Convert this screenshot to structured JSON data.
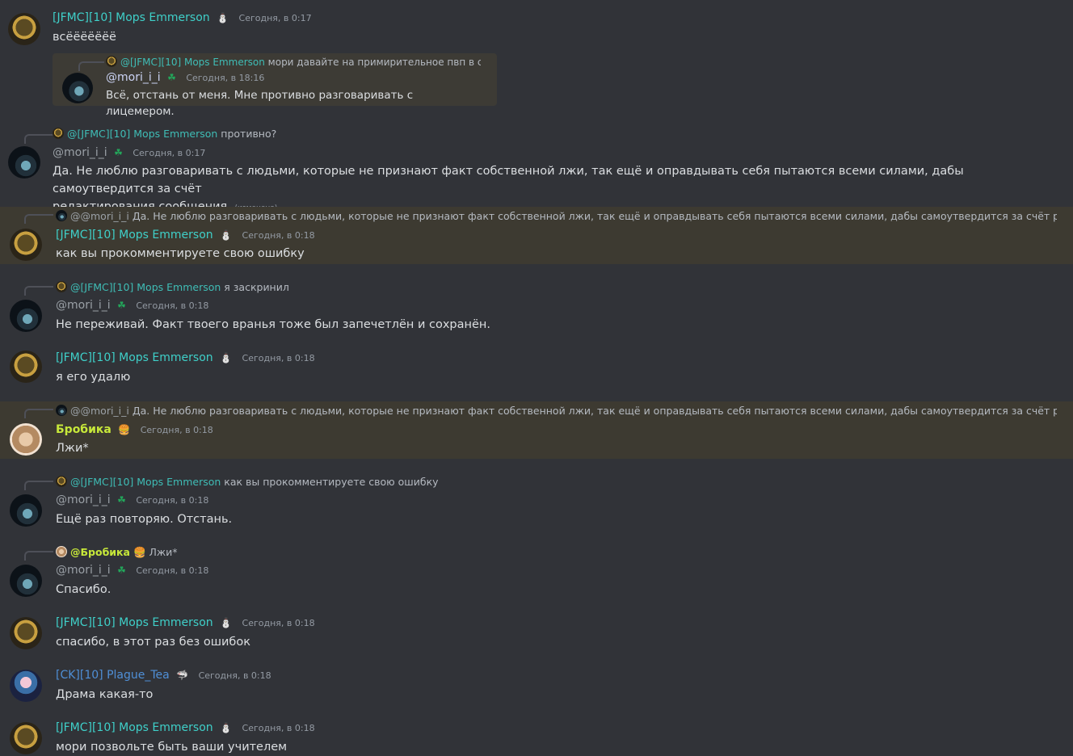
{
  "messages": [
    {
      "author": "[JFMC][10] Mops Emmerson",
      "badge": "⛄",
      "timestamp": "Сегодня, в 0:17",
      "text": "всёёёёёёё",
      "quote": {
        "reply_author": "@[JFMC][10] Mops Emmerson",
        "reply_text": "мори давайте на примирительное пвп в самп?",
        "author": "@mori_i_i",
        "badge": "☘",
        "timestamp": "Сегодня, в 18:16",
        "text": "Всё, отстань от меня. Мне противно разговаривать с лицемером."
      }
    },
    {
      "reply_author": "@[JFMC][10] Mops Emmerson",
      "reply_text": "противно?",
      "author": "@mori_i_i",
      "badge": "☘",
      "timestamp": "Сегодня, в 0:17",
      "text_line1": "Да. Не люблю разговаривать с людьми, которые не признают факт собственной лжи, так ещё и оправдывать себя пытаются всеми силами, дабы самоутвердится за счёт",
      "text_line2": "редактирования сообщения.",
      "edited": "(изменено)"
    },
    {
      "reply_author": "@@mori_i_i",
      "reply_text": "Да. Не люблю разговаривать с людьми, которые не признают факт собственной лжи, так ещё и оправдывать себя пытаются всеми силами, дабы самоутвердится за счёт редактировани",
      "author": "[JFMC][10] Mops Emmerson",
      "badge": "⛄",
      "timestamp": "Сегодня, в 0:18",
      "text": "как вы прокомментируете свою ошибку"
    },
    {
      "reply_author": "@[JFMC][10] Mops Emmerson",
      "reply_text": "я заскринил",
      "author": "@mori_i_i",
      "badge": "☘",
      "timestamp": "Сегодня, в 0:18",
      "text": "Не переживай. Факт твоего вранья тоже был запечетлён и сохранён."
    },
    {
      "author": "[JFMC][10] Mops Emmerson",
      "badge": "⛄",
      "timestamp": "Сегодня, в 0:18",
      "text": "я его удалю"
    },
    {
      "reply_author": "@@mori_i_i",
      "reply_text": "Да. Не люблю разговаривать с людьми, которые не признают факт собственной лжи, так ещё и оправдывать себя пытаются всеми силами, дабы самоутвердится за счёт редактировани",
      "author": "Бробика",
      "badge": "🍔",
      "timestamp": "Сегодня, в 0:18",
      "text": "Лжи*"
    },
    {
      "reply_author": "@[JFMC][10] Mops Emmerson",
      "reply_text": "как вы прокомментируете свою ошибку",
      "author": "@mori_i_i",
      "badge": "☘",
      "timestamp": "Сегодня, в 0:18",
      "text": "Ещё раз повторяю. Отстань."
    },
    {
      "reply_author": "@Бробика",
      "reply_badge": "🍔",
      "reply_text": "Лжи*",
      "author": "@mori_i_i",
      "badge": "☘",
      "timestamp": "Сегодня, в 0:18",
      "text": "Спасибо."
    },
    {
      "author": "[JFMC][10] Mops Emmerson",
      "badge": "⛄",
      "timestamp": "Сегодня, в 0:18",
      "text": "спасибо, в этот раз без ошибок"
    },
    {
      "author": "[CK][10] Plague_Tea",
      "badge": "🦈",
      "timestamp": "Сегодня, в 0:18",
      "text": "Драма какая-то"
    },
    {
      "author": "[JFMC][10] Mops Emmerson",
      "badge": "⛄",
      "timestamp": "Сегодня, в 0:18",
      "text": "мори позвольте быть ваши учителем"
    }
  ],
  "colors": {
    "background": "#313338",
    "highlight": "#3d3a31",
    "mops": "#3fd0c9",
    "mori": "#9aa0a6",
    "brobika": "#c7e83a",
    "plague": "#4f8fd6"
  }
}
